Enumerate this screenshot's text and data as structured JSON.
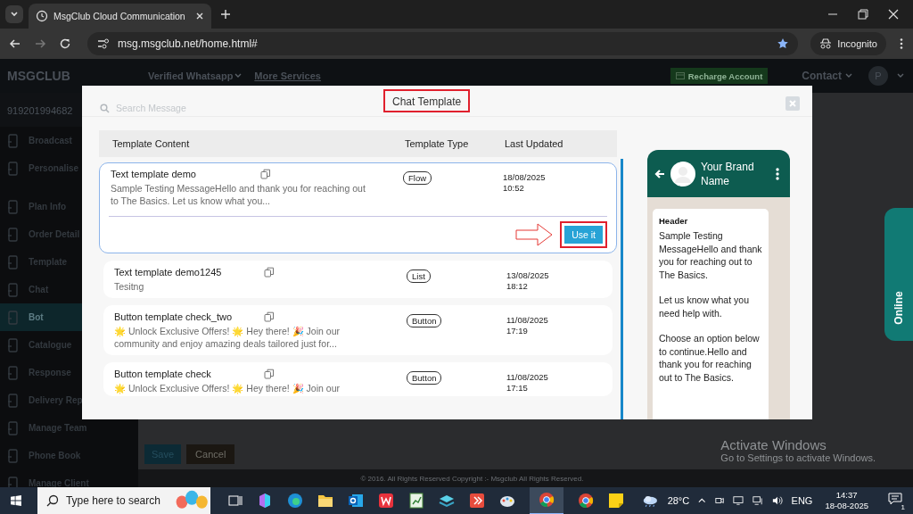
{
  "browser": {
    "tab_title": "MsgClub Cloud Communication",
    "url": "msg.msgclub.net/home.html#",
    "profile": "Incognito"
  },
  "header": {
    "logo": "MSGCLUB",
    "nav": [
      {
        "label": "Verified Whatsapp",
        "dropdown": true
      },
      {
        "label": "More Services",
        "dropdown": false
      }
    ],
    "recharge": "Recharge Account",
    "contact": "Contact",
    "avatar": "P"
  },
  "sidebar": {
    "account": "919201994682",
    "items": [
      {
        "label": "Broadcast",
        "selected": false
      },
      {
        "label": "Personalise",
        "selected": false
      },
      {
        "label": "Plan Info",
        "selected": false
      },
      {
        "label": "Order Detail",
        "selected": false
      },
      {
        "label": "Template",
        "selected": false
      },
      {
        "label": "Chat",
        "selected": false
      },
      {
        "label": "Bot",
        "selected": true
      },
      {
        "label": "Catalogue",
        "selected": false
      },
      {
        "label": "Response",
        "selected": false
      },
      {
        "label": "Delivery Rep",
        "selected": false
      },
      {
        "label": "Manage Team",
        "selected": false
      },
      {
        "label": "Phone Book",
        "selected": false
      },
      {
        "label": "Manage Client",
        "selected": false
      }
    ]
  },
  "modal": {
    "title": "Chat Template",
    "search": {
      "placeholder": "Search Message"
    },
    "columns": [
      "Template Content",
      "Template Type",
      "Last Updated"
    ],
    "rows": [
      {
        "name": "Text template demo",
        "preview": "Sample Testing MessageHello and thank you for reaching out to The Basics. Let us know what you...",
        "type": "Flow",
        "date": "18/08/2025",
        "time": "10:52",
        "selected": true,
        "action": "Use it"
      },
      {
        "name": "Text template demo1245",
        "preview": "Tesitng",
        "type": "List",
        "date": "13/08/2025",
        "time": "18:12",
        "selected": false
      },
      {
        "name": "Button template check_two",
        "preview": "🌟 Unlock Exclusive Offers! 🌟 Hey there! 🎉 Join our community and enjoy amazing deals tailored just for...",
        "type": "Button",
        "date": "11/08/2025",
        "time": "17:19",
        "selected": false
      },
      {
        "name": "Button template check",
        "preview": "🌟 Unlock Exclusive Offers! 🌟 Hey there! 🎉 Join our",
        "type": "Button",
        "date": "11/08/2025",
        "time": "17:15",
        "selected": false
      }
    ],
    "preview": {
      "brand": "Your Brand Name",
      "header": "Header",
      "paragraphs": [
        "Sample Testing MessageHello and thank you for reaching out to The Basics.",
        "Let us know what you need help with.",
        "Choose an option below to continue.Hello and thank you for reaching out to The Basics."
      ]
    }
  },
  "form_buttons": [
    "Save",
    "Cancel"
  ],
  "footer": "© 2016. All Rights Reserved Copyright :- Msgclub All Rights Reserved.",
  "online_tab": "Online",
  "activation": {
    "title": "Activate Windows",
    "subtitle": "Go to Settings to activate Windows."
  },
  "taskbar": {
    "search": {
      "placeholder": "Type here to search"
    },
    "temperature": "28°C",
    "language": "ENG",
    "time": "14:37",
    "date": "18-08-2025",
    "notifications": "1"
  }
}
